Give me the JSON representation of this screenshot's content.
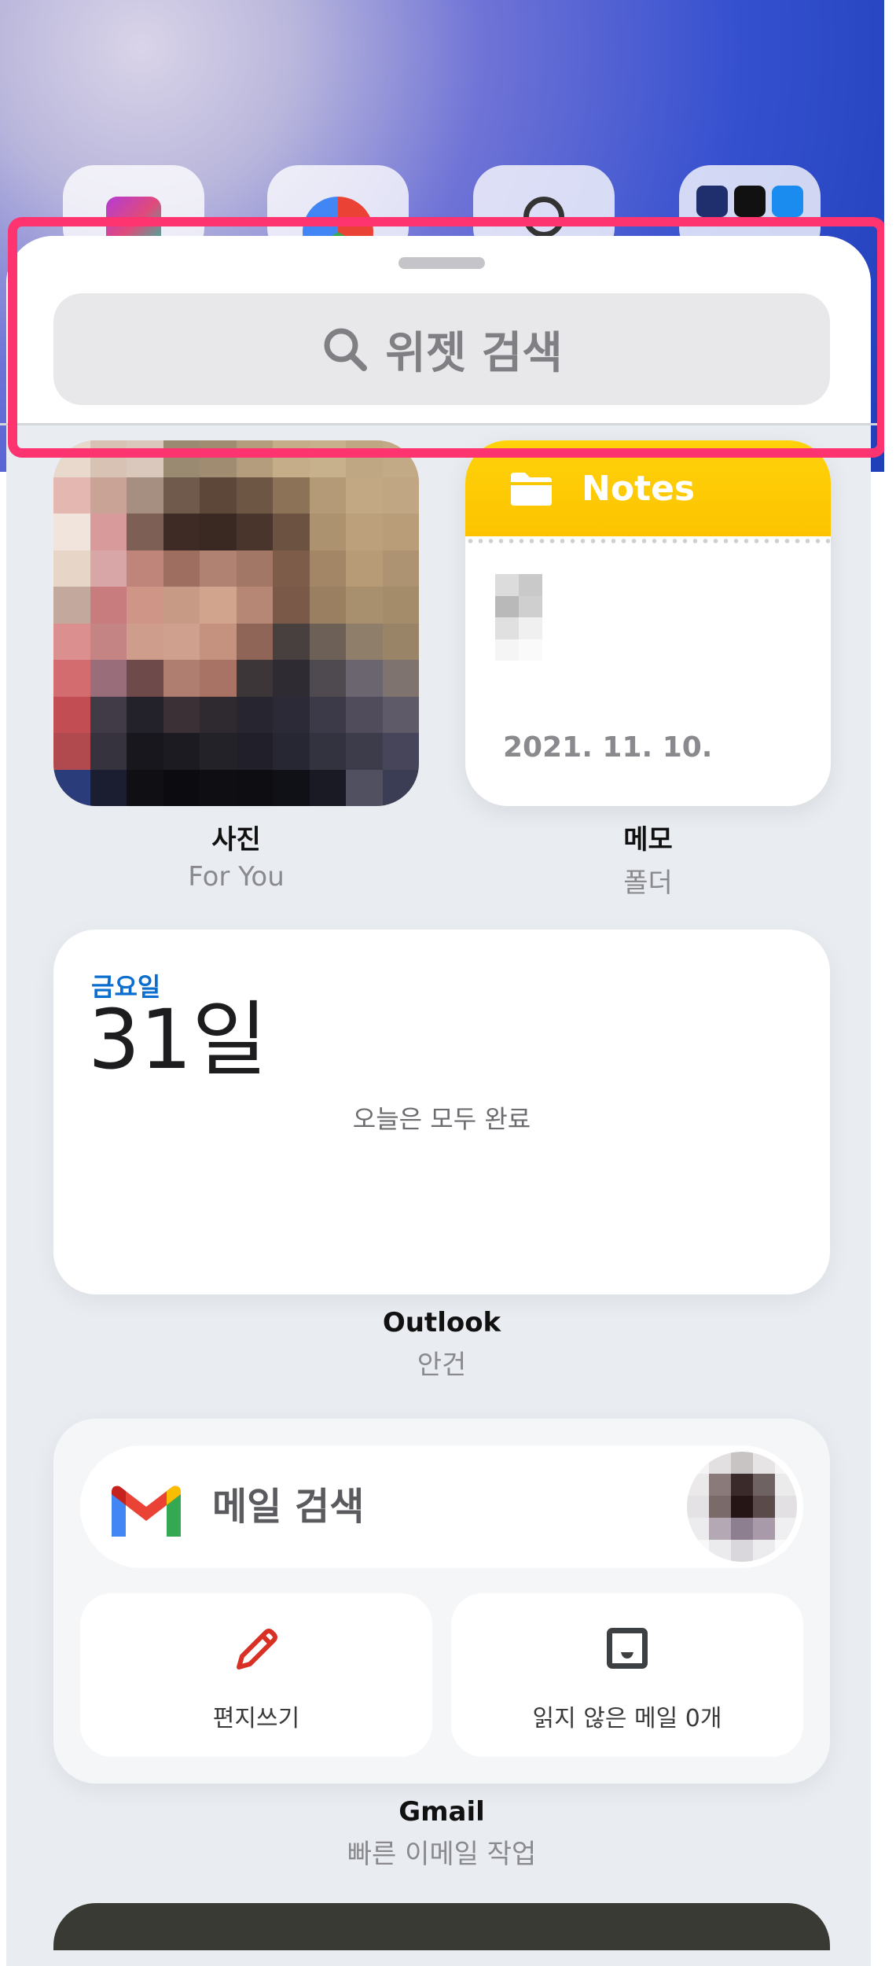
{
  "search": {
    "placeholder": "위젯 검색"
  },
  "notes": {
    "header": "Notes",
    "date": "2021. 11. 10."
  },
  "widgets": {
    "photos": {
      "title": "사진",
      "subtitle": "For You"
    },
    "notes": {
      "title": "메모",
      "subtitle": "폴더"
    },
    "outlook": {
      "title": "Outlook",
      "subtitle": "안건",
      "weekday": "금요일",
      "date": "31일",
      "empty_text": "오늘은 모두 완료"
    },
    "gmail": {
      "title": "Gmail",
      "subtitle": "빠른 이메일 작업",
      "search_label": "메일 검색",
      "compose_label": "편지쓰기",
      "unread_label": "읽지 않은 메일 0개"
    }
  },
  "icons": {
    "search": "search-icon",
    "folder": "folder-icon",
    "gmail": "gmail-logo-icon",
    "compose": "pencil-icon",
    "inbox": "inbox-icon"
  },
  "colors": {
    "accent_highlight": "#fe3470",
    "notes_yellow": "#fcc400",
    "outlook_blue": "#0a6ed1",
    "gmail_red": "#d93025"
  }
}
